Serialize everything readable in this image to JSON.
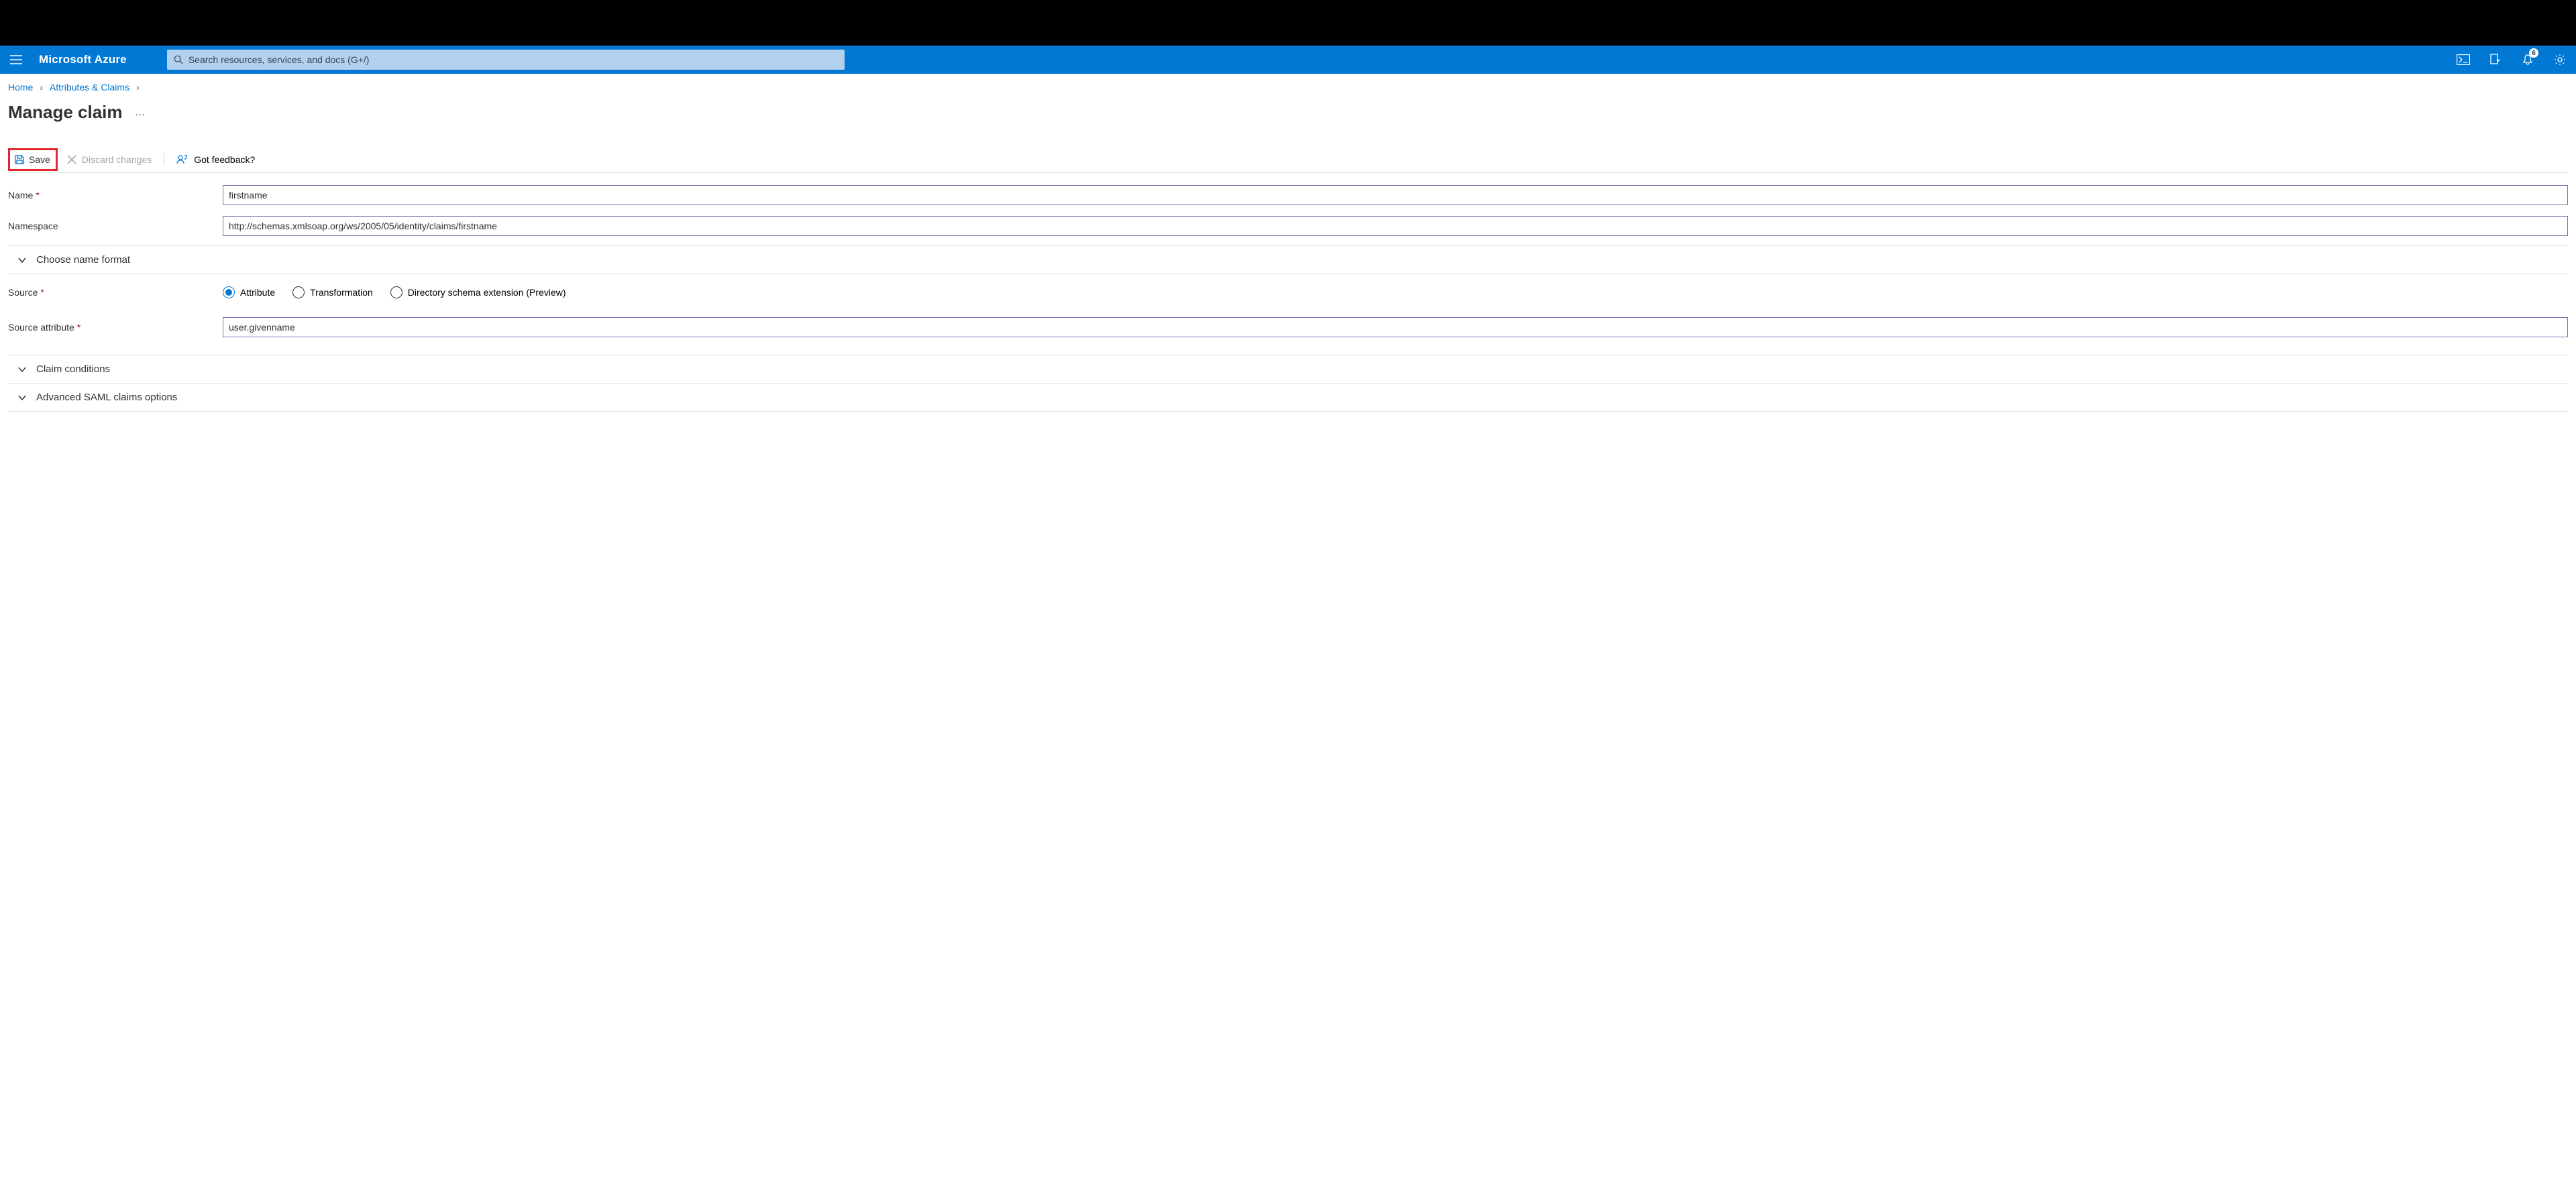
{
  "header": {
    "brand": "Microsoft Azure",
    "search_placeholder": "Search resources, services, and docs (G+/)",
    "notification_count": "6"
  },
  "breadcrumb": {
    "home": "Home",
    "attributes": "Attributes & Claims"
  },
  "page": {
    "title": "Manage claim"
  },
  "toolbar": {
    "save": "Save",
    "discard": "Discard changes",
    "feedback": "Got feedback?"
  },
  "form": {
    "name_label": "Name",
    "name_value": "firstname",
    "namespace_label": "Namespace",
    "namespace_value": "http://schemas.xmlsoap.org/ws/2005/05/identity/claims/firstname",
    "choose_format": "Choose name format",
    "source_label": "Source",
    "source_attr_label": "Source attribute",
    "source_attr_value": "user.givenname",
    "radio_attribute": "Attribute",
    "radio_transformation": "Transformation",
    "radio_directory": "Directory schema extension (Preview)",
    "claim_conditions": "Claim conditions",
    "advanced_saml": "Advanced SAML claims options"
  }
}
